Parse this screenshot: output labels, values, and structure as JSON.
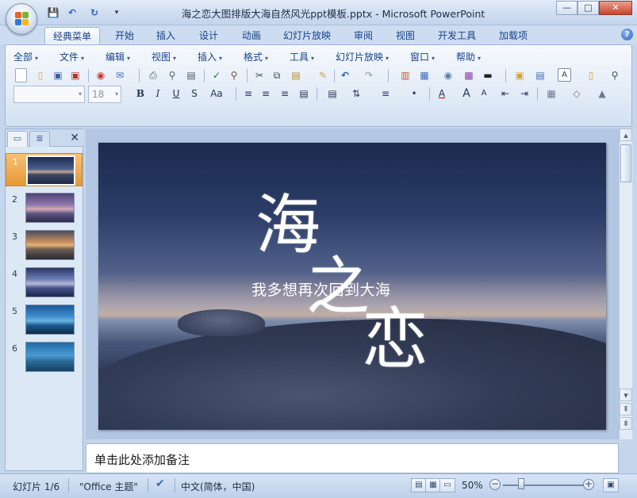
{
  "window": {
    "title": "海之恋大图排版大海自然风光ppt模板.pptx - Microsoft PowerPoint",
    "controls": {
      "minimize": "—",
      "maximize": "□",
      "close": "✕"
    }
  },
  "quick_access": {
    "save": "💾",
    "undo": "↶",
    "redo": "↻",
    "customize": "▾"
  },
  "ribbon_tabs": [
    {
      "label": "经典菜单",
      "active": true
    },
    {
      "label": "开始"
    },
    {
      "label": "插入"
    },
    {
      "label": "设计"
    },
    {
      "label": "动画"
    },
    {
      "label": "幻灯片放映"
    },
    {
      "label": "审阅"
    },
    {
      "label": "视图"
    },
    {
      "label": "开发工具"
    },
    {
      "label": "加载项"
    }
  ],
  "help_label": "?",
  "classic_menu": [
    "全部",
    "文件",
    "编辑",
    "视图",
    "插入",
    "格式",
    "工具",
    "幻灯片放映",
    "窗口",
    "帮助"
  ],
  "toolbar": {
    "font_name": "",
    "font_size": "18",
    "bold": "B",
    "italic": "I",
    "underline": "U",
    "strike": "S",
    "change_case": "Aa",
    "grow_font": "A",
    "shrink_font": "A",
    "text_box": "A"
  },
  "panel": {
    "tab_slides": "▭",
    "tab_outline": "≣",
    "close": "✕",
    "slides": [
      {
        "num": "1",
        "active": true
      },
      {
        "num": "2"
      },
      {
        "num": "3"
      },
      {
        "num": "4"
      },
      {
        "num": "5"
      },
      {
        "num": "6"
      }
    ]
  },
  "slide": {
    "char1": "海",
    "char2": "之",
    "char3": "恋",
    "subtitle": "我多想再次回到大海"
  },
  "scrollbar": {
    "up": "▲",
    "down": "▼",
    "prev": "⇞",
    "next": "⇟"
  },
  "notes": {
    "placeholder": "单击此处添加备注"
  },
  "status": {
    "slide_info": "幻灯片 1/6",
    "theme": "\"Office 主题\"",
    "language": "中文(简体，中国)",
    "zoom": "50%",
    "zoom_out": "−",
    "zoom_in": "+"
  },
  "colors": {
    "accent_active": "#e69733",
    "ribbon_text": "#15428b",
    "close_button": "#c8432c"
  }
}
